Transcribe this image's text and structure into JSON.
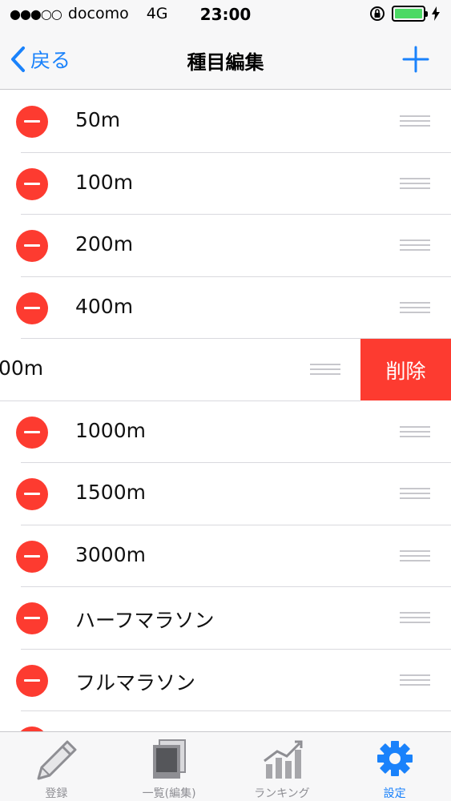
{
  "status_bar": {
    "signal": "●●●○○",
    "carrier": "docomo",
    "network": "4G",
    "time": "23:00",
    "battery_fill": 1.0
  },
  "nav": {
    "back_label": "戻る",
    "title": "種目編集"
  },
  "events": [
    {
      "label": "50m"
    },
    {
      "label": "100m"
    },
    {
      "label": "200m"
    },
    {
      "label": "400m"
    },
    {
      "label": "00m",
      "swiped": true
    },
    {
      "label": "1000m"
    },
    {
      "label": "1500m"
    },
    {
      "label": "3000m"
    },
    {
      "label": "ハーフマラソン"
    },
    {
      "label": "フルマラソン"
    }
  ],
  "swipe_delete_label": "削除",
  "tabs": [
    {
      "label": "登録",
      "icon": "pencil-icon",
      "active": false
    },
    {
      "label": "一覧(編集)",
      "icon": "photos-icon",
      "active": false
    },
    {
      "label": "ランキング",
      "icon": "chart-icon",
      "active": false
    },
    {
      "label": "設定",
      "icon": "gear-icon",
      "active": true
    }
  ],
  "colors": {
    "accent": "#1a82fb",
    "delete": "#fd3b30",
    "battery": "#4cd964"
  }
}
